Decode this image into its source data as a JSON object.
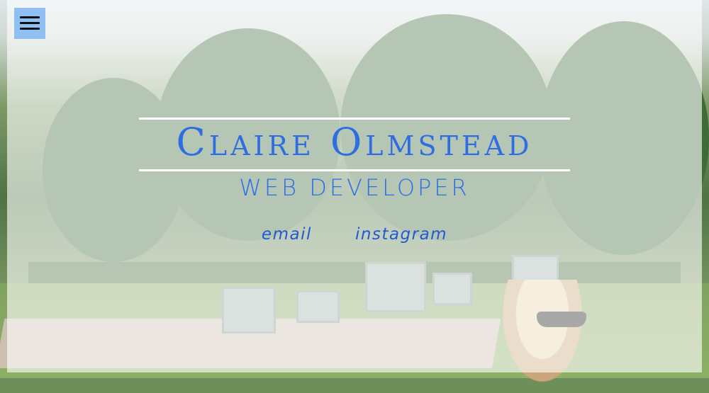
{
  "header": {
    "menu_icon": "hamburger-menu-icon",
    "name": "Claire Olmstead",
    "role": "WEB DEVELOPER"
  },
  "links": [
    {
      "label": "email"
    },
    {
      "label": "instagram"
    }
  ],
  "colors": {
    "accent": "#2f6de3",
    "menu_button": "#8fbff3",
    "overlay": "#ffffff"
  }
}
